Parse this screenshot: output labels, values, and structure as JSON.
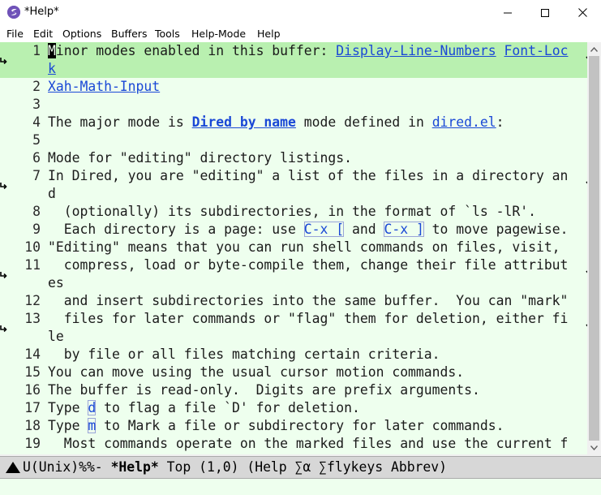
{
  "window": {
    "title": "*Help*",
    "icon": "emacs-icon"
  },
  "menubar": {
    "items": [
      "File",
      "Edit",
      "Options",
      "Buffers",
      "Tools",
      "Help-Mode",
      "Help"
    ]
  },
  "editor": {
    "lines": [
      {
        "num": "1",
        "segments": [
          {
            "t": "M",
            "s": "cursor"
          },
          {
            "t": "inor modes enabled in this buffer: ",
            "s": ""
          },
          {
            "t": "Display-Line-Numbers",
            "s": "link"
          },
          {
            "t": " ",
            "s": ""
          },
          {
            "t": "Font-Loc",
            "s": "link"
          }
        ],
        "wrapped": true,
        "hl": true
      },
      {
        "num": "",
        "segments": [
          {
            "t": "k",
            "s": "link"
          }
        ],
        "cont": true,
        "hl": true
      },
      {
        "num": "2",
        "segments": [
          {
            "t": "Xah-Math-Input",
            "s": "link"
          }
        ]
      },
      {
        "num": "3",
        "segments": []
      },
      {
        "num": "4",
        "segments": [
          {
            "t": "The major mode is ",
            "s": ""
          },
          {
            "t": "Dired by name",
            "s": "bold-link"
          },
          {
            "t": " mode defined in ",
            "s": ""
          },
          {
            "t": "dired.el",
            "s": "link"
          },
          {
            "t": ":",
            "s": ""
          }
        ]
      },
      {
        "num": "5",
        "segments": []
      },
      {
        "num": "6",
        "segments": [
          {
            "t": "Mode for \"editing\" directory listings.",
            "s": ""
          }
        ]
      },
      {
        "num": "7",
        "segments": [
          {
            "t": "In Dired, you are \"editing\" a list of the files in a directory an",
            "s": ""
          }
        ],
        "wrapped": true
      },
      {
        "num": "",
        "segments": [
          {
            "t": "d",
            "s": ""
          }
        ],
        "cont": true
      },
      {
        "num": "8",
        "segments": [
          {
            "t": "  (optionally) its subdirectories, in the format of `ls -lR'.",
            "s": ""
          }
        ]
      },
      {
        "num": "9",
        "segments": [
          {
            "t": "  Each directory is a page: use ",
            "s": ""
          },
          {
            "t": "C-x [",
            "s": "kbd"
          },
          {
            "t": " and ",
            "s": ""
          },
          {
            "t": "C-x ]",
            "s": "kbd"
          },
          {
            "t": " to move pagewise.",
            "s": ""
          }
        ]
      },
      {
        "num": "10",
        "segments": [
          {
            "t": "\"Editing\" means that you can run shell commands on files, visit,",
            "s": ""
          }
        ]
      },
      {
        "num": "11",
        "segments": [
          {
            "t": "  compress, load or byte-compile them, change their file attribut",
            "s": ""
          }
        ],
        "wrapped": true
      },
      {
        "num": "",
        "segments": [
          {
            "t": "es",
            "s": ""
          }
        ],
        "cont": true
      },
      {
        "num": "12",
        "segments": [
          {
            "t": "  and insert subdirectories into the same buffer.  You can \"mark\"",
            "s": ""
          }
        ]
      },
      {
        "num": "13",
        "segments": [
          {
            "t": "  files for later commands or \"flag\" them for deletion, either fi",
            "s": ""
          }
        ],
        "wrapped": true
      },
      {
        "num": "",
        "segments": [
          {
            "t": "le",
            "s": ""
          }
        ],
        "cont": true
      },
      {
        "num": "14",
        "segments": [
          {
            "t": "  by file or all files matching certain criteria.",
            "s": ""
          }
        ]
      },
      {
        "num": "15",
        "segments": [
          {
            "t": "You can move using the usual cursor motion commands.",
            "s": ""
          }
        ]
      },
      {
        "num": "16",
        "segments": [
          {
            "t": "The buffer is read-only.  Digits are prefix arguments.",
            "s": ""
          }
        ]
      },
      {
        "num": "17",
        "segments": [
          {
            "t": "Type ",
            "s": ""
          },
          {
            "t": "d",
            "s": "kbd"
          },
          {
            "t": " to flag a file `D' for deletion.",
            "s": ""
          }
        ]
      },
      {
        "num": "18",
        "segments": [
          {
            "t": "Type ",
            "s": ""
          },
          {
            "t": "m",
            "s": "kbd"
          },
          {
            "t": " to Mark a file or subdirectory for later commands.",
            "s": ""
          }
        ]
      },
      {
        "num": "19",
        "segments": [
          {
            "t": "  Most commands operate on the marked files and use the current f",
            "s": ""
          }
        ]
      }
    ]
  },
  "modeline": {
    "prefix": "U(Unix)%%- ",
    "buffer": "*Help*",
    "rest": " Top (1,0) (Help ∑α ∑flykeys Abbrev)"
  }
}
